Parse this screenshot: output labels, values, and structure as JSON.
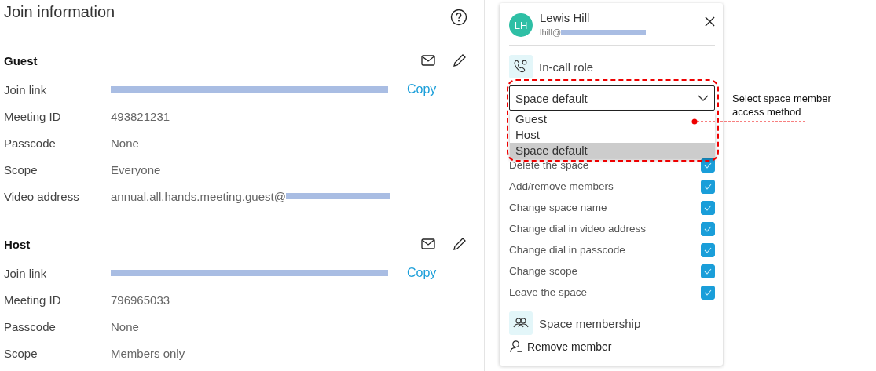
{
  "join_info": {
    "title": "Join information",
    "sections": [
      {
        "heading": "Guest",
        "rows": [
          {
            "kind": "link",
            "label": "Join link",
            "action": "Copy"
          },
          {
            "kind": "text",
            "label": "Meeting ID",
            "value": "493821231"
          },
          {
            "kind": "text",
            "label": "Passcode",
            "value": "None"
          },
          {
            "kind": "text",
            "label": "Scope",
            "value": "Everyone"
          },
          {
            "kind": "address",
            "label": "Video address",
            "value": "annual.all.hands.meeting.guest@"
          }
        ]
      },
      {
        "heading": "Host",
        "rows": [
          {
            "kind": "link",
            "label": "Join link",
            "action": "Copy"
          },
          {
            "kind": "text",
            "label": "Meeting ID",
            "value": "796965033"
          },
          {
            "kind": "text",
            "label": "Passcode",
            "value": "None"
          },
          {
            "kind": "text",
            "label": "Scope",
            "value": "Members only"
          }
        ]
      }
    ]
  },
  "member_panel": {
    "initials": "LH",
    "name": "Lewis Hill",
    "email": "lhill@",
    "role_title": "In-call role",
    "dropdown": {
      "value": "Space default",
      "expanded": true,
      "options": [
        {
          "label": "Guest",
          "selected": false
        },
        {
          "label": "Host",
          "selected": false
        },
        {
          "label": "Space default",
          "selected": true
        }
      ]
    },
    "permissions": [
      {
        "label": "Delete the space",
        "checked": true
      },
      {
        "label": "Add/remove members",
        "checked": true
      },
      {
        "label": "Change space name",
        "checked": true
      },
      {
        "label": "Change dial in video address",
        "checked": true
      },
      {
        "label": "Change dial in passcode",
        "checked": true
      },
      {
        "label": "Change scope",
        "checked": true
      },
      {
        "label": "Leave the space",
        "checked": true
      }
    ],
    "membership_title": "Space membership",
    "remove_action": "Remove member"
  },
  "annotation": {
    "text": "Select space member access method"
  }
}
